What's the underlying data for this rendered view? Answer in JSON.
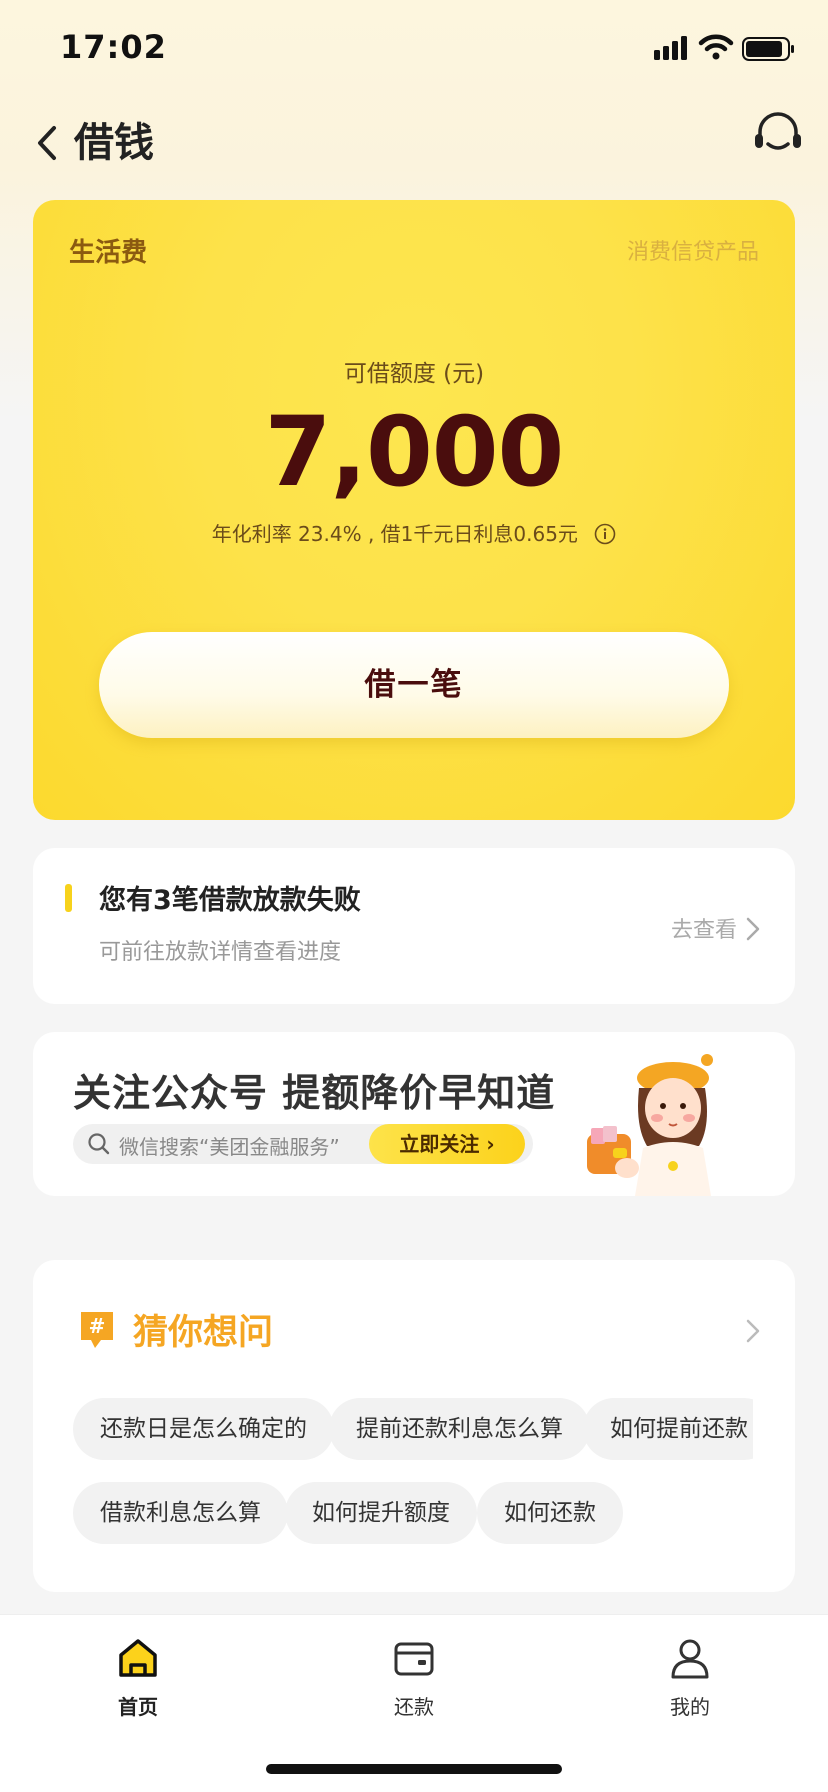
{
  "status_bar": {
    "time": "17:02"
  },
  "nav": {
    "title": "借钱"
  },
  "hero": {
    "tag": "生活费",
    "product": "消费信贷产品",
    "limit_label": "可借额度 (元)",
    "amount": "7,000",
    "rate_text": "年化利率 23.4% , 借1千元日利息0.65元",
    "borrow_button": "借一笔"
  },
  "notice": {
    "title": "您有3笔借款放款失败",
    "subtitle": "可前往放款详情查看进度",
    "link": "去查看"
  },
  "follow_banner": {
    "title": "关注公众号 提额降价早知道",
    "search_text": "微信搜索“美团金融服务”",
    "button": "立即关注 ›"
  },
  "faq": {
    "title": "猜你想问",
    "row1": [
      "还款日是怎么确定的",
      "提前还款利息怎么算",
      "如何提前还款"
    ],
    "row2": [
      "借款利息怎么算",
      "如何提升额度",
      "如何还款"
    ]
  },
  "tabbar": {
    "items": [
      {
        "label": "首页",
        "icon": "home-icon",
        "active": true
      },
      {
        "label": "还款",
        "icon": "wallet-icon",
        "active": false
      },
      {
        "label": "我的",
        "icon": "user-icon",
        "active": false
      }
    ]
  },
  "colors": {
    "accent_yellow": "#fde24a",
    "amount_text": "#4a0d0d",
    "faq_title": "#f5a623"
  }
}
